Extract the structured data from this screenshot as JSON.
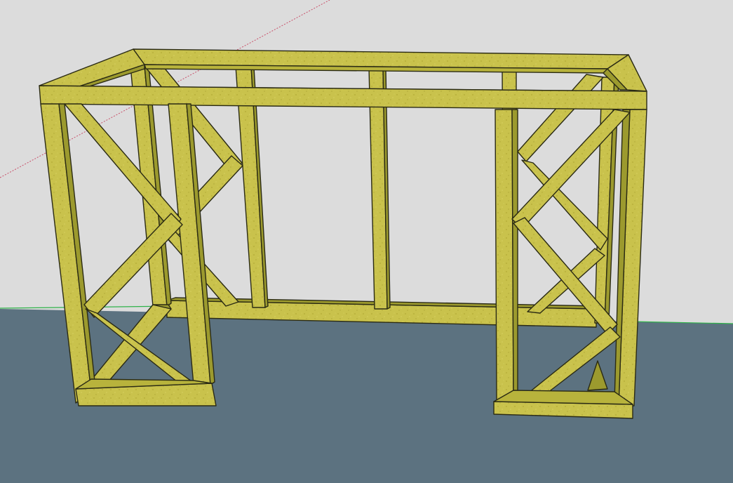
{
  "viewport": {
    "sky_color": "#dcdcdc",
    "ground_color": "#5c7280",
    "wood_color": "#c9c24c",
    "wood_shadow_color": "#9c9a2e",
    "axis_red_color": "#c8506a",
    "axis_green_color": "#2fb24a"
  },
  "model": {
    "description_icon": "wooden-frame-model"
  }
}
